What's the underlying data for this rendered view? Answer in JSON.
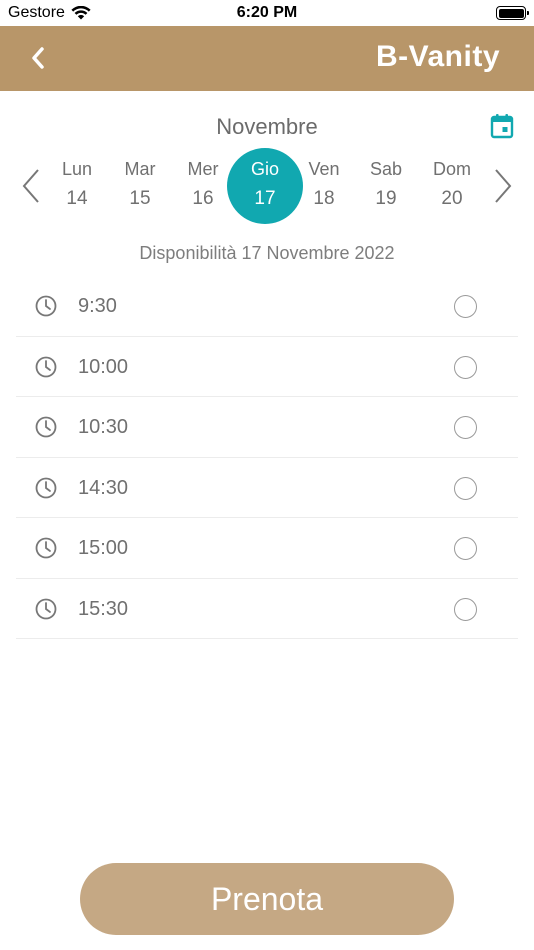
{
  "status_bar": {
    "carrier": "Gestore",
    "time": "6:20 PM"
  },
  "header": {
    "title": "B-Vanity",
    "back_icon": "chevron-left-icon",
    "background_color": "#b89669"
  },
  "calendar": {
    "month": "Novembre",
    "calendar_icon": "calendar-icon",
    "accent_color": "#11a8b0",
    "days": [
      {
        "name": "Lun",
        "number": "14",
        "selected": false
      },
      {
        "name": "Mar",
        "number": "15",
        "selected": false
      },
      {
        "name": "Mer",
        "number": "16",
        "selected": false
      },
      {
        "name": "Gio",
        "number": "17",
        "selected": true
      },
      {
        "name": "Ven",
        "number": "18",
        "selected": false
      },
      {
        "name": "Sab",
        "number": "19",
        "selected": false
      },
      {
        "name": "Dom",
        "number": "20",
        "selected": false
      }
    ]
  },
  "availability_label": "Disponibilità 17 Novembre 2022",
  "slots": [
    {
      "time": "9:30",
      "selected": false
    },
    {
      "time": "10:00",
      "selected": false
    },
    {
      "time": "10:30",
      "selected": false
    },
    {
      "time": "14:30",
      "selected": false
    },
    {
      "time": "15:00",
      "selected": false
    },
    {
      "time": "15:30",
      "selected": false
    }
  ],
  "book_button": {
    "label": "Prenota",
    "color": "#c5a884"
  }
}
